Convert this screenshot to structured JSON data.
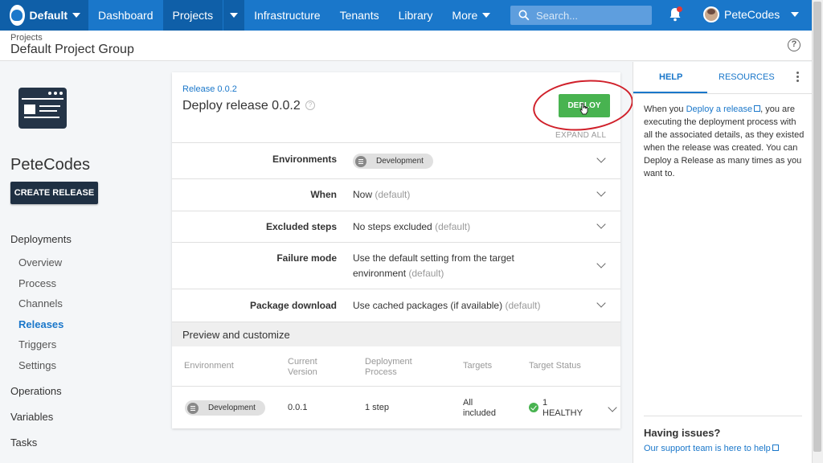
{
  "topnav": {
    "space": "Default",
    "items": [
      "Dashboard",
      "Projects",
      "Infrastructure",
      "Tenants",
      "Library",
      "More"
    ],
    "search_placeholder": "Search...",
    "user": "PeteCodes"
  },
  "header": {
    "breadcrumb": "Projects",
    "title": "Default Project Group"
  },
  "sidebar": {
    "project_name": "PeteCodes",
    "create_release": "CREATE RELEASE",
    "deployments": "Deployments",
    "links": [
      "Overview",
      "Process",
      "Channels",
      "Releases",
      "Triggers",
      "Settings"
    ],
    "active_link": "Releases",
    "operations": "Operations",
    "variables": "Variables",
    "tasks": "Tasks"
  },
  "release": {
    "link": "Release 0.0.2",
    "title": "Deploy release 0.0.2",
    "help_glyph": "?",
    "deploy": "DEPLOY",
    "expand_all": "EXPAND ALL",
    "options": {
      "environments": {
        "label": "Environments",
        "chip": "Development"
      },
      "when": {
        "label": "When",
        "value": "Now",
        "default": "(default)"
      },
      "excluded": {
        "label": "Excluded steps",
        "value": "No steps excluded",
        "default": "(default)"
      },
      "failure": {
        "label": "Failure mode",
        "value_line1": "Use the default setting from the target",
        "value_line2": "environment",
        "default": "(default)"
      },
      "package": {
        "label": "Package download",
        "value": "Use cached packages (if available)",
        "default": "(default)"
      }
    },
    "preview": {
      "title": "Preview and customize",
      "headers": [
        "Environment",
        "Current",
        "Version",
        "Deployment",
        "Process",
        "Targets",
        "Target Status"
      ],
      "row": {
        "environment": "Development",
        "version": "0.0.1",
        "process": "1 step",
        "targets_line1": "All",
        "targets_line2": "included",
        "status_line1": "1",
        "status_line2": "HEALTHY"
      }
    }
  },
  "help_panel": {
    "tabs": [
      "HELP",
      "RESOURCES"
    ],
    "text_before": "When you ",
    "link": "Deploy a release",
    "text_after": ", you are executing the deployment process with all the associated details, as they existed when the release was created. You can Deploy a Release as many times as you want to.",
    "issues_title": "Having issues?",
    "issues_link": "Our support team is here to help"
  },
  "colors": {
    "nav": "#1a77ca",
    "nav_active": "#0f5fa8",
    "deploy": "#48b350",
    "annotation_ring": "#d0202a"
  }
}
